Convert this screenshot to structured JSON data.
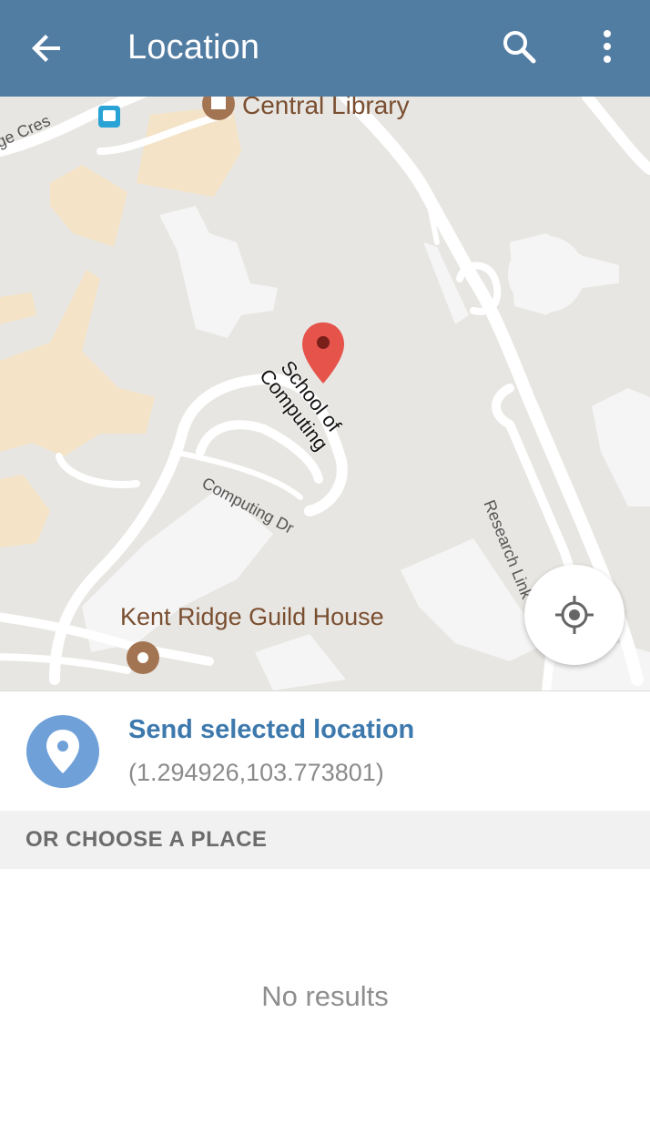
{
  "appbar": {
    "title": "Location",
    "back_icon": "arrow-left-icon",
    "search_icon": "search-icon",
    "more_icon": "more-vertical-icon",
    "color": "#527da3"
  },
  "map": {
    "labels": {
      "library": "Central Library",
      "guild_house": "Kent Ridge Guild House",
      "school_line1": "School of",
      "school_line2": "Computing",
      "computing_dr": "Computing Dr",
      "research_link": "Research Link",
      "ridge_cres": "ge Cres"
    },
    "marker_icon": "map-pin-icon",
    "my_location_icon": "crosshair-icon"
  },
  "send": {
    "title": "Send selected location",
    "coords": "(1.294926,103.773801)",
    "icon": "location-pin-icon",
    "accent": "#3d79ad"
  },
  "section": {
    "label": "OR CHOOSE A PLACE"
  },
  "results": {
    "empty_text": "No results"
  }
}
